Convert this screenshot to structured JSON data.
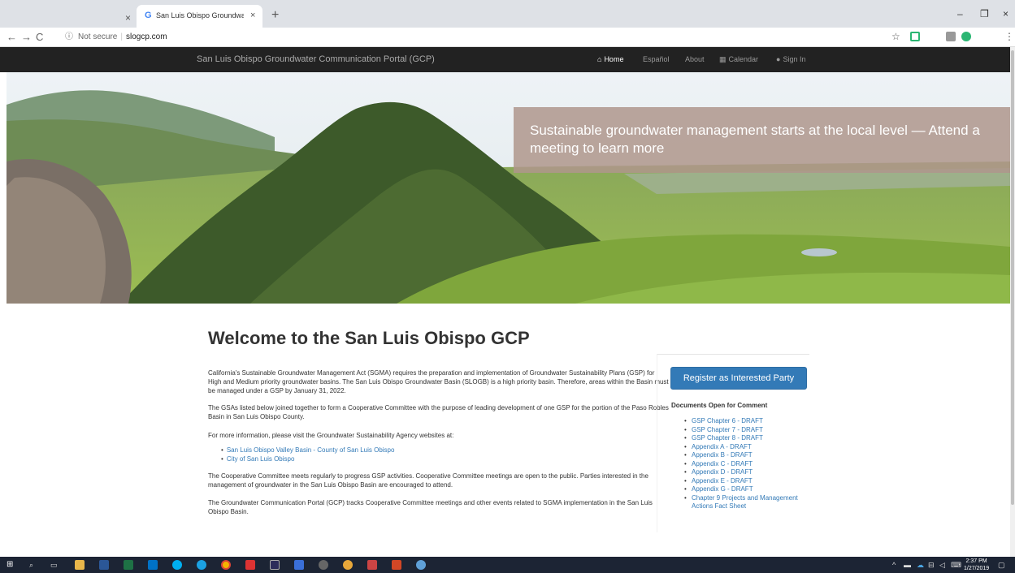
{
  "browser": {
    "prev_tab_close": "×",
    "active_tab_title": "San Luis Obispo Groundwater Co",
    "active_tab_close": "×",
    "new_tab": "+",
    "security_label": "Not secure",
    "url": "slogcp.com",
    "window_controls": [
      "–",
      "❐",
      "×"
    ]
  },
  "site_nav": {
    "brand": "San Luis Obispo Groundwater Communication Portal (GCP)",
    "items": [
      {
        "label": "Home",
        "icon": "home-icon",
        "active": true
      },
      {
        "label": "Español",
        "icon": "",
        "active": false
      },
      {
        "label": "About",
        "icon": "",
        "active": false
      },
      {
        "label": "Calendar",
        "icon": "calendar-icon",
        "active": false
      },
      {
        "label": "Sign In",
        "icon": "user-icon",
        "active": false
      }
    ]
  },
  "hero": {
    "banner_text": "Sustainable groundwater management starts at the local level — Attend a meeting to learn more"
  },
  "main": {
    "title": "Welcome to the San Luis Obispo GCP",
    "paragraphs": [
      "California's Sustainable Groundwater Management Act (SGMA) requires the preparation and implementation of Groundwater Sustainability Plans (GSP) for High and Medium priority groundwater basins. The San Luis Obispo Groundwater Basin (SLOGB) is a high priority basin. Therefore, areas within the Basin must be managed under a GSP by January 31, 2022.",
      "The GSAs listed below joined together to form a Cooperative Committee with the purpose of leading development of one GSP for the portion of the Paso Robles Basin in San Luis Obispo County.",
      "For more information, please visit the Groundwater Sustainability Agency websites at:",
      "The Cooperative Committee meets regularly to progress GSP activities. Cooperative Committee meetings are open to the public. Parties interested in the management of groundwater in the San Luis Obispo Basin are encouraged to attend.",
      "The Groundwater Communication Portal (GCP) tracks Cooperative Committee meetings and other events related to SGMA implementation in the San Luis Obispo Basin."
    ],
    "agency_links": [
      "San Luis Obispo Valley Basin - County of San Luis Obispo",
      "City of San Luis Obispo"
    ]
  },
  "sidebar": {
    "register_button": "Register as Interested Party",
    "docs_heading": "Documents Open for Comment",
    "docs": [
      "GSP Chapter 6 - DRAFT",
      "GSP Chapter 7 - DRAFT",
      "GSP Chapter 8 - DRAFT",
      "Appendix A - DRAFT",
      "Appendix B - DRAFT",
      "Appendix C - DRAFT",
      "Appendix D - DRAFT",
      "Appendix E - DRAFT",
      "Appendix G - DRAFT",
      "Chapter 9 Projects and Management Actions Fact Sheet"
    ]
  },
  "taskbar": {
    "clock_time": "2:37 PM",
    "clock_date": "1/27/2019"
  },
  "colors": {
    "nav_bg": "#222222",
    "link": "#337ab7",
    "button": "#337ab7",
    "banner": "#af968c",
    "taskbar": "#1c2434"
  }
}
